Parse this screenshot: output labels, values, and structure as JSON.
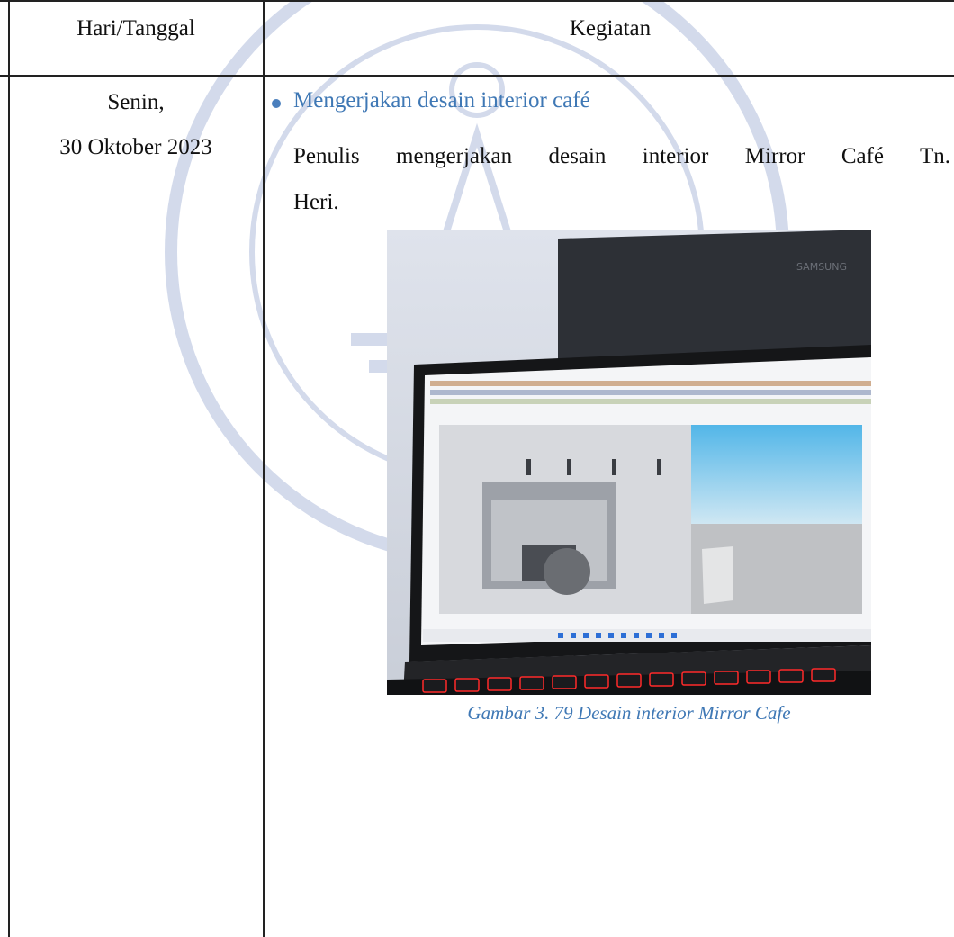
{
  "table": {
    "header": {
      "date": "Hari/Tanggal",
      "activity": "Kegiatan"
    },
    "rows": [
      {
        "day": "Senin,",
        "date": "30 Oktober 2023",
        "activity_title": "Mengerjakan desain interior café",
        "activity_desc_line1": "Penulis mengerjakan desain interior Mirror Café Tn.",
        "activity_desc_line2": "Heri.",
        "figure_caption": "Gambar 3. 79 Desain interior Mirror Cafe"
      }
    ]
  },
  "photo": {
    "monitor_brand": "SAMSUNG"
  },
  "colors": {
    "accent": "#3f78b5",
    "keyboard_glow": "#ff2a2a"
  }
}
